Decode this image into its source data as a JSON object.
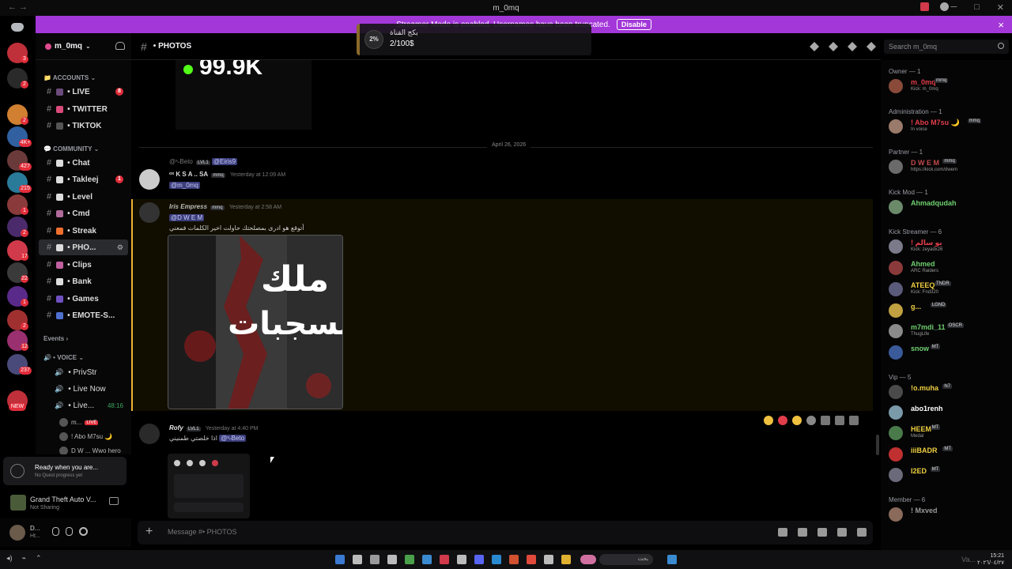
{
  "window": {
    "title": "m_0mq",
    "nav": "← →"
  },
  "banner": {
    "text": "Streamer Mode is enabled. Usernames have been truncated.",
    "disable_label": "Disable",
    "close": "×"
  },
  "overlay": {
    "percent": "2%",
    "line1": "بكج القناة",
    "line2": "2/100$"
  },
  "server": {
    "name": "m_0mq",
    "channel_header": "• PHOTOS"
  },
  "guild_badges": [
    "3",
    "2",
    "2",
    "4K+",
    "427",
    "215",
    "1",
    "2",
    "17",
    "22",
    "1",
    "2",
    "12",
    "237",
    "NEW"
  ],
  "channels": {
    "cat_accounts": "ACCOUNTS",
    "cat_community": "COMMUNITY",
    "cat_events": "Events",
    "cat_voice": "• VOICE",
    "items": [
      {
        "label": "• LIVE",
        "badge": "8",
        "color": "#6b4b7b"
      },
      {
        "label": "• TWITTER",
        "badge": "",
        "color": "#d94b7b"
      },
      {
        "label": "• TIKTOK",
        "badge": "",
        "color": "#555555"
      },
      {
        "label": "• Chat",
        "badge": "",
        "color": "#dddddd"
      },
      {
        "label": "• Takleej",
        "badge": "1",
        "color": "#dddddd"
      },
      {
        "label": "• Level",
        "badge": "",
        "color": "#dddddd"
      },
      {
        "label": "• Cmd",
        "badge": "",
        "color": "#b06b9b"
      },
      {
        "label": "• Streak",
        "badge": "",
        "color": "#f07030"
      },
      {
        "label": "• PHO...",
        "badge": "",
        "color": "#dddddd"
      },
      {
        "label": "• Clips",
        "badge": "",
        "color": "#c060a0"
      },
      {
        "label": "• Bank",
        "badge": "",
        "color": "#dddddd"
      },
      {
        "label": "• Games",
        "badge": "",
        "color": "#7050c0"
      },
      {
        "label": "• EMOTE-S...",
        "badge": "",
        "color": "#5070d0"
      }
    ],
    "voice": [
      {
        "label": "• PrivStr"
      },
      {
        "label": "• Live Now"
      },
      {
        "label": "• Live...",
        "timer": "48:16"
      }
    ],
    "voice_users": [
      {
        "name": "m...",
        "live": "LIVE"
      },
      {
        "name": "! Abo M7su 🌙"
      },
      {
        "name": "D W ...  Wwo hero"
      }
    ]
  },
  "quest": {
    "title": "Ready when you are...",
    "sub": "No Quest progress yet"
  },
  "game": {
    "title": "Grand Theft Auto V...",
    "sub": "Not Sharing"
  },
  "user": {
    "name": "D...",
    "status": "Ht..."
  },
  "search": {
    "placeholder": "Search m_0mq"
  },
  "chat": {
    "stat": "99.9K",
    "date_divider": "April 26, 2026",
    "messages": [
      {
        "reply_user": "@ˣ˶Beto",
        "reply_tag": "LVL1",
        "reply_mention": "@Eiris9",
        "author": "ᵒˣ K S A ..  SA",
        "tag": "mmq",
        "time": "Yesterday at 12:09 AM",
        "text": "@m_0mq"
      },
      {
        "author": "Iris Empress",
        "tag": "mmq",
        "time": "Yesterday at 2:58 AM",
        "mention": "@D W E M",
        "text": "أتوقع هو ادرى بمصلحتك حاولت اخير الكلمات فمعني",
        "poster_line1": "ملك",
        "poster_line2": "السجبات"
      },
      {
        "author": "Rofy",
        "tag": "LVL1",
        "time": "Yesterday at 4:40 PM",
        "text": "اذا خلصتي طمنيني",
        "mention": "@ˣ˶Beto"
      }
    ]
  },
  "composer": {
    "placeholder": "Message #• PHOTOS",
    "plus": "+"
  },
  "members": {
    "groups": [
      {
        "title": "Owner — 1",
        "members": [
          {
            "name": "m_0mq",
            "status": "Kick: m_0mq",
            "color": "#e23d4a",
            "tag": "mmq"
          }
        ]
      },
      {
        "title": "Administration — 1",
        "members": [
          {
            "name": "! Abo M7su 🌙",
            "status": "In voice",
            "color": "#e23d4a",
            "tag": "mmq"
          }
        ]
      },
      {
        "title": "Partner — 1",
        "members": [
          {
            "name": "D W E M",
            "status": "https://kick.com/dwem",
            "color": "#c14a4a",
            "tag": "mmq"
          }
        ]
      },
      {
        "title": "Kick Mod — 1",
        "members": [
          {
            "name": "Ahmadqudah",
            "status": "",
            "color": "#6fd06f",
            "tag": ""
          }
        ]
      },
      {
        "title": "Kick Streamer — 6",
        "members": [
          {
            "name": "! يو سالم",
            "status": "Kick: zeyadx26",
            "color": "#e23d4a",
            "tag": ""
          },
          {
            "name": "Ahmed",
            "status": "ARC Raiders",
            "color": "#6fd06f",
            "tag": ""
          },
          {
            "name": "ATEEQ",
            "status": "Kick: Fnd320",
            "color": "#f0d040",
            "tag": "TNDR"
          },
          {
            "name": "g...",
            "status": "",
            "color": "#f0d040",
            "tag": "LGND"
          },
          {
            "name": "m7mdi_11",
            "status": "ThugLife",
            "color": "#6fd06f",
            "tag": "OSCR"
          },
          {
            "name": "snow",
            "status": "",
            "color": "#6fd06f",
            "tag": "MT"
          }
        ]
      },
      {
        "title": "Vip — 5",
        "members": [
          {
            "name": "!o.muha",
            "status": "",
            "color": "#f0d040",
            "tag": "N7"
          },
          {
            "name": "abo1renh",
            "status": "",
            "color": "#ffffff",
            "tag": ""
          },
          {
            "name": "HEEM",
            "status": "Medal",
            "color": "#f0d040",
            "tag": "MT"
          },
          {
            "name": "iiiBADR",
            "status": "",
            "color": "#f0d040",
            "tag": "MT"
          },
          {
            "name": "I2ED",
            "status": "",
            "color": "#f0d040",
            "tag": "MT"
          }
        ]
      },
      {
        "title": "Member — 6",
        "members": [
          {
            "name": "! Mxved",
            "status": "",
            "color": "#999999",
            "tag": ""
          }
        ]
      }
    ]
  },
  "taskbar": {
    "search": "بحث",
    "time": "15:21",
    "date": "٢٠٢٦/٠٤/٢٧",
    "watermark": "Va..."
  },
  "colors": {
    "banner": "#a337d8",
    "accent": "#5865f2",
    "highlight_border": "#f0b232",
    "kick_green": "#53fc18"
  }
}
